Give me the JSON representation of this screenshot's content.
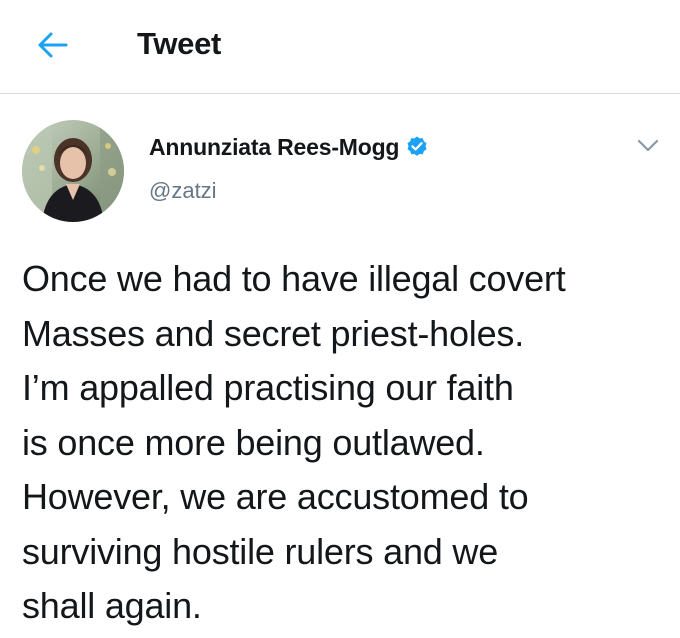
{
  "header": {
    "title": "Tweet",
    "back_icon": "back-arrow-icon"
  },
  "tweet": {
    "author": {
      "display_name": "Annunziata Rees-Mogg",
      "handle": "@zatzi",
      "verified": true,
      "verified_icon": "verified-badge-icon"
    },
    "more_icon": "chevron-down-icon",
    "text": "Once we had to have illegal covert\nMasses and secret priest-holes.\nI’m appalled practising our faith\nis once more being outlawed.\nHowever, we are accustomed to\nsurviving hostile rulers and we\nshall again."
  },
  "colors": {
    "accent": "#1da1f2",
    "text": "#14171a",
    "secondary_text": "#657786",
    "divider": "#d9dde1"
  }
}
